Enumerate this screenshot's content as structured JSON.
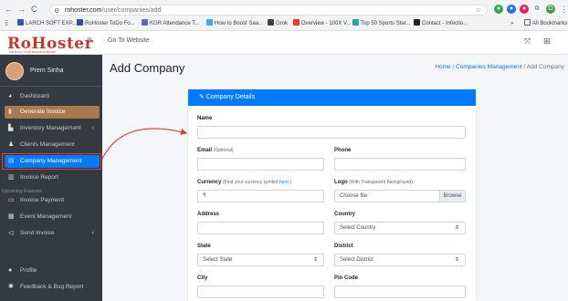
{
  "browser": {
    "back": "←",
    "forward": "→",
    "reload": "C",
    "url_host": "rohoster.com",
    "url_path": "/user/companies/add",
    "bookmarks": [
      "LARCH SOFT EXP...",
      "RoHoster ToDo Fo...",
      "KGR Attendance T...",
      "How to Boost Saa...",
      "Grok",
      "Overview - 100X V...",
      "Top 50 Sports Star...",
      "Contact - Infectio..."
    ],
    "bookmark_colors": [
      "#3f51b5",
      "#3949ab",
      "#5c6bc0",
      "#42a5f5",
      "#424242",
      "#e53935",
      "#26a69a",
      "#212121"
    ],
    "more": "»",
    "all_bookmarks": "All Bookmarks",
    "profile_letter": "O"
  },
  "topbar": {
    "logo": "RoHoster",
    "tagline": "WE BUILD YOUR BUSINESS BRAND",
    "go_to_website": "Go To Website"
  },
  "sidebar": {
    "user_name": "Prem Sinha",
    "items": [
      {
        "label": "Dashboard",
        "icon": "palette-icon"
      },
      {
        "label": "Generate Invoice",
        "icon": "file-icon"
      },
      {
        "label": "Inventory Management",
        "icon": "warehouse-icon"
      },
      {
        "label": "Clients Management",
        "icon": "users-icon"
      },
      {
        "label": "Company Management",
        "icon": "building-icon"
      },
      {
        "label": "Invoice Report",
        "icon": "file-invoice-icon"
      },
      {
        "label": "Invoice Payment",
        "icon": "credit-card-icon"
      },
      {
        "label": "Event Management",
        "icon": "calendar-icon"
      },
      {
        "label": "Send Invoice",
        "icon": "send-icon"
      },
      {
        "label": "Profile",
        "icon": "user-icon"
      },
      {
        "label": "Feedback & Bug Report",
        "icon": "bug-icon"
      }
    ],
    "upcoming_label": "Upcoming Features"
  },
  "page": {
    "title": "Add Company",
    "breadcrumb": {
      "home": "Home",
      "sep": "/",
      "section": "Companies Management",
      "current": "Add Company"
    }
  },
  "form": {
    "header": "Company Details",
    "name_label": "Name",
    "email_label": "Email",
    "email_hint": "(Optional)",
    "phone_label": "Phone",
    "currency_label": "Currency",
    "currency_hint": "(Find your currency symbol",
    "currency_link": "here.",
    "currency_hint_end": ")",
    "currency_value": "₹",
    "logo_label": "Logo",
    "logo_hint": "(With Transparent Background)",
    "logo_placeholder": "Choose file",
    "browse": "Browse",
    "address_label": "Address",
    "country_label": "Country",
    "country_value": "Select Country",
    "state_label": "State",
    "state_value": "Select State",
    "district_label": "District",
    "district_value": "Select District",
    "city_label": "City",
    "pincode_label": "Pin Code"
  },
  "colors": {
    "primary": "#007bff",
    "sidebar": "#343a40",
    "logo": "#c0392b",
    "highlight": "#e53935",
    "generate": "#a87a4f"
  }
}
